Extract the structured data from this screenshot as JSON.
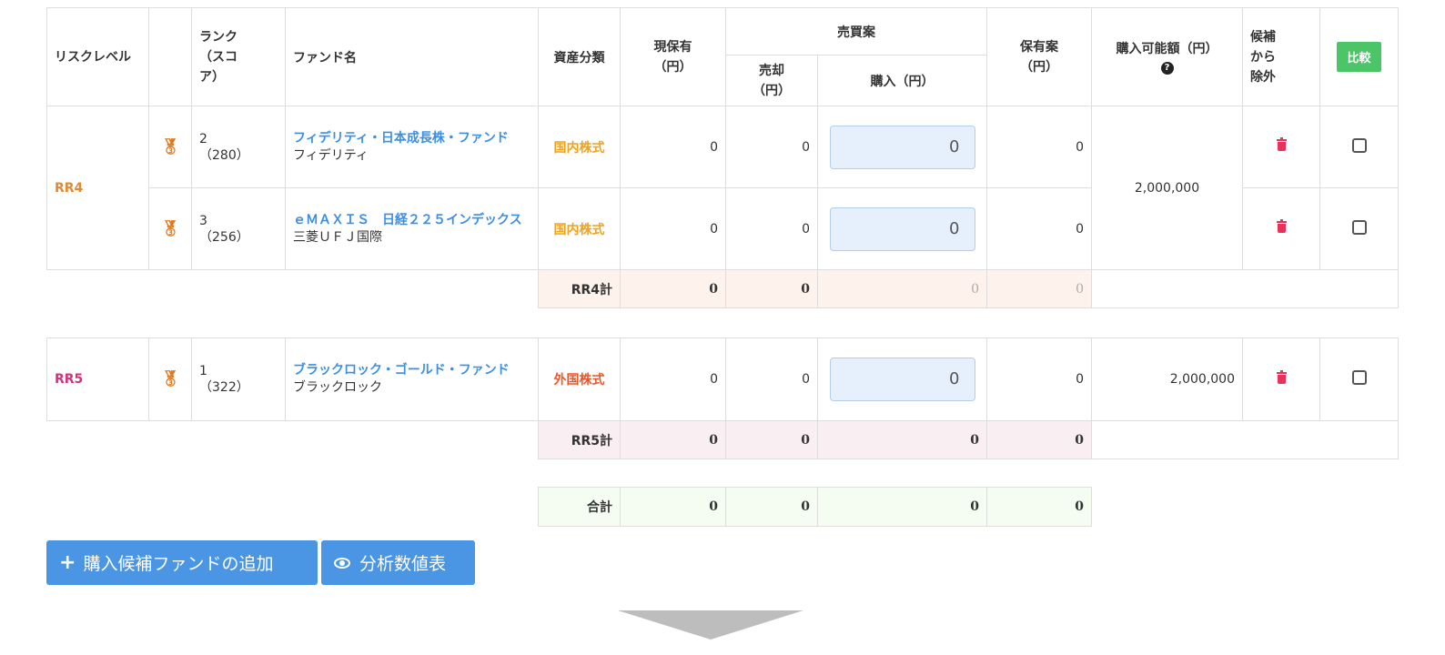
{
  "header": {
    "risk_level": "リスクレベル",
    "rank": "ランク（スコア）",
    "fund_name": "ファンド名",
    "asset_class": "資産分類",
    "current_holding": "現保有（円）",
    "trade_plan": "売買案",
    "sell": "売却（円）",
    "buy": "購入（円）",
    "holding_plan": "保有案（円）",
    "purchasable": "購入可能額（円）",
    "help_icon": "?",
    "exclude": "候補から除外",
    "compare_button": "比較"
  },
  "rr4_group": {
    "risk_label": "RR4",
    "purchasable_amount": "2,000,000",
    "rows": [
      {
        "rank": "2",
        "score": "（280）",
        "fund_name": "フィデリティ・日本成長株・ファンド",
        "company": "フィデリティ",
        "asset_class": "国内株式",
        "current": "0",
        "sell": "0",
        "buy": "0",
        "holding": "0"
      },
      {
        "rank": "3",
        "score": "（256）",
        "fund_name": "ｅＭＡＸＩＳ　日経２２５インデックス",
        "company": "三菱ＵＦＪ国際",
        "asset_class": "国内株式",
        "current": "0",
        "sell": "0",
        "buy": "0",
        "holding": "0"
      }
    ],
    "subtotal": {
      "label": "RR4計",
      "current": "0",
      "sell": "0",
      "buy": "0",
      "holding": "0"
    }
  },
  "rr5_group": {
    "risk_label": "RR5",
    "purchasable_amount": "2,000,000",
    "row": {
      "rank": "1",
      "score": "（322）",
      "fund_name": "ブラックロック・ゴールド・ファンド",
      "company": "ブラックロック",
      "asset_class": "外国株式",
      "current": "0",
      "sell": "0",
      "buy": "0",
      "holding": "0"
    },
    "subtotal": {
      "label": "RR5計",
      "current": "0",
      "sell": "0",
      "buy": "0",
      "holding": "0"
    }
  },
  "total": {
    "label": "合計",
    "current": "0",
    "sell": "0",
    "buy": "0",
    "holding": "0"
  },
  "buttons": {
    "add_fund": "購入候補ファンドの追加",
    "analysis_table": "分析数値表"
  },
  "icons": {
    "medal": "medal-icon",
    "trash": "trash-icon",
    "plus": "plus-icon",
    "eye": "eye-icon",
    "question": "question-circle-icon"
  },
  "colors": {
    "rr4": "#e08a35",
    "rr5": "#d6317d",
    "link": "#3d8fe2",
    "button_blue": "#4a95e4",
    "compare_green": "#4cc569",
    "trash_red": "#e8315b"
  }
}
